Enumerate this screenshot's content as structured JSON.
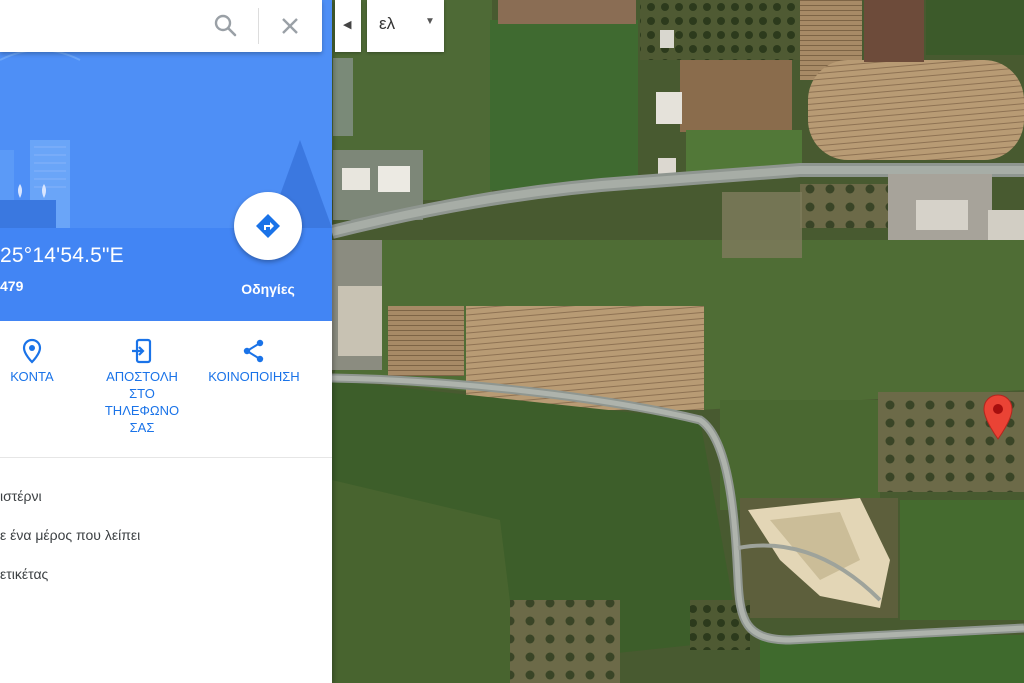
{
  "search": {
    "value": "",
    "placeholder": ""
  },
  "place": {
    "coordinates": "25°14'54.5\"E",
    "plus_code": "479",
    "directions_label": "Οδηγίες"
  },
  "actions": [
    {
      "label": "ΚΟΝΤΑ",
      "icon": "location-pin-icon"
    },
    {
      "label": "ΑΠΟΣΤΟΛΗ ΣΤΟ ΤΗΛΕΦΩΝΟ ΣΑΣ",
      "icon": "send-to-phone-icon"
    },
    {
      "label": "ΚΟΙΝΟΠΟΙΗΣΗ",
      "icon": "share-icon"
    }
  ],
  "links": [
    {
      "label": "ιστέρνι"
    },
    {
      "label": "ε ένα μέρος που λείπει"
    },
    {
      "label": "ετικέτας"
    }
  ],
  "map": {
    "language_label": "ελ",
    "marker_color": "#ea4335"
  },
  "colors": {
    "accent": "#4285f4",
    "link": "#1a73e8"
  }
}
